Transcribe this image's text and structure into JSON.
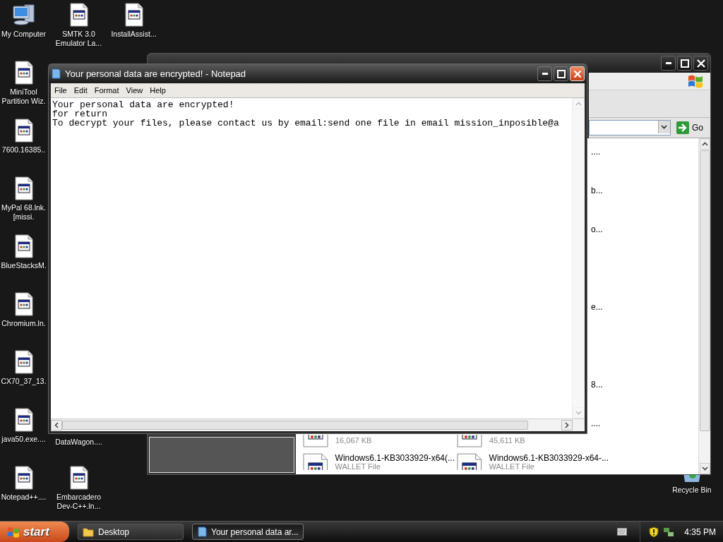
{
  "desktop_icons": [
    {
      "label": "My Computer",
      "kind": "computer"
    },
    {
      "label": "SMTK 3.0 Emulator La...",
      "kind": "file"
    },
    {
      "label": "InstallAssist...",
      "kind": "file"
    },
    {
      "label": "MiniTool Partition Wiz.",
      "kind": "file"
    },
    {
      "label": "7600.16385..",
      "kind": "file"
    },
    {
      "label": "MyPal 68.lnk.[missi.",
      "kind": "file"
    },
    {
      "label": "BlueStacksM.",
      "kind": "file"
    },
    {
      "label": "Chromium.ln.",
      "kind": "file"
    },
    {
      "label": "CX70_37_13.",
      "kind": "file"
    },
    {
      "label": "java50.exe....",
      "kind": "file"
    },
    {
      "label": "DataWagon....",
      "kind": "label_only"
    },
    {
      "label": "Notepad++....",
      "kind": "file"
    },
    {
      "label": "Embarcadero Dev-C++.ln...",
      "kind": "file"
    },
    {
      "label": "Recycle Bin",
      "kind": "recycle"
    }
  ],
  "explorer": {
    "go_label": "Go",
    "name_tails": [
      "....",
      "b...",
      "o...",
      "e...",
      "8...",
      "...."
    ],
    "tiles": [
      {
        "size": "16,067 KB"
      },
      {
        "size": "45,611 KB"
      },
      {
        "name": "Windows6.1-KB3033929-x64(...",
        "type": "WALLET File"
      },
      {
        "name": "Windows6.1-KB3033929-x64-...",
        "type": "WALLET File"
      }
    ]
  },
  "notepad": {
    "title": "Your personal data are encrypted! - Notepad",
    "menu": [
      "File",
      "Edit",
      "Format",
      "View",
      "Help"
    ],
    "lines": [
      "Your personal data are encrypted!",
      "for return",
      "To decrypt your files, please contact us by email:send one file in email mission_inposible@a"
    ]
  },
  "taskbar": {
    "start_label": "start",
    "tasks": [
      {
        "label": "Desktop",
        "kind": "folder",
        "selected": false
      },
      {
        "label": "Your personal data ar...",
        "kind": "notepad",
        "selected": true
      }
    ],
    "clock": "4:35 PM"
  }
}
